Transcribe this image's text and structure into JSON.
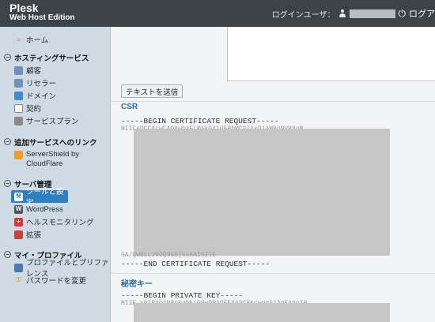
{
  "header": {
    "brand": "Plesk",
    "edition": "Web Host Edition",
    "login_user_label": "ログインユーザ：",
    "logout_label": "ログア"
  },
  "sidebar": {
    "home": "ホーム",
    "hosting": {
      "title": "ホスティングサービス",
      "items": [
        "顧客",
        "リセラー",
        "ドメイン",
        "契約",
        "サービスプラン"
      ]
    },
    "links": {
      "title": "追加サービスへのリンク",
      "items": [
        "ServerShield by CloudFlare"
      ]
    },
    "server": {
      "title": "サーバ管理",
      "items": [
        "ツールと設定",
        "WordPress",
        "ヘルスモニタリング",
        "拡張"
      ]
    },
    "profile": {
      "title": "マイ・プロファイル",
      "items": [
        "プロファイルとプリファレンス",
        "パスワードを変更"
      ]
    }
  },
  "main": {
    "send_button": "テキストを送信",
    "csr_title": "CSR",
    "csr_begin": "-----BEGIN CERTIFICATE REQUEST-----",
    "csr_end": "-----END CERTIFICATE REQUEST-----",
    "key_title": "秘密キー",
    "key_begin": "-----BEGIN PRIVATE KEY-----"
  }
}
